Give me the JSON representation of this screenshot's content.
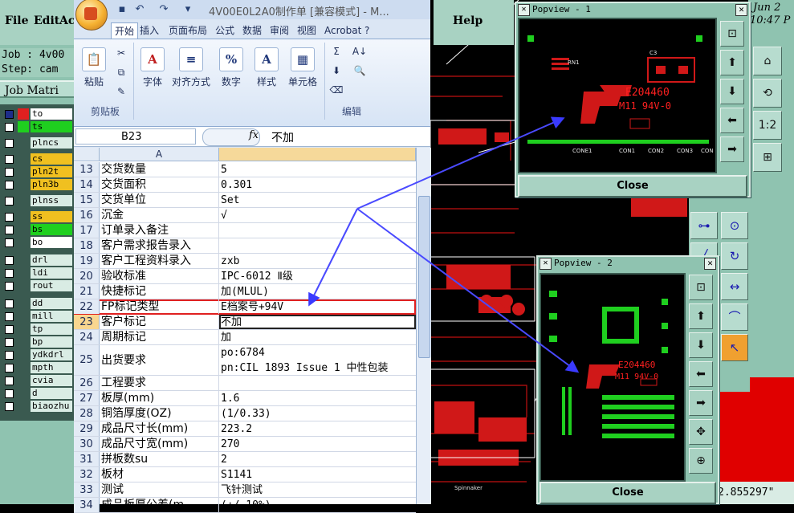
{
  "cam": {
    "menu": [
      "File",
      "Edit",
      "Ac"
    ],
    "job": "Job : 4v00",
    "step": "Step: cam",
    "job_matrix": "Job Matri",
    "layers": [
      {
        "name": "to",
        "color": "#ffffff",
        "swatch": "#e02020",
        "checked": true
      },
      {
        "name": "ts",
        "color": "#1fcf1f",
        "swatch": "#1fcf1f",
        "checked": false
      },
      {
        "name": "plncs",
        "color": "#d9ece4",
        "swatch": "",
        "checked": false
      },
      {
        "name": "cs",
        "color": "#f0c020",
        "swatch": "",
        "checked": false
      },
      {
        "name": "pln2t",
        "color": "#f0c020",
        "swatch": "",
        "checked": false
      },
      {
        "name": "pln3b",
        "color": "#f0c020",
        "swatch": "",
        "checked": false
      },
      {
        "name": "plnss",
        "color": "#d9ece4",
        "swatch": "",
        "checked": false
      },
      {
        "name": "ss",
        "color": "#f0c020",
        "swatch": "",
        "checked": false
      },
      {
        "name": "bs",
        "color": "#1fcf1f",
        "swatch": "",
        "checked": false
      },
      {
        "name": "bo",
        "color": "#ffffff",
        "swatch": "",
        "checked": false
      },
      {
        "name": "drl",
        "color": "#d9ece4",
        "swatch": "",
        "checked": false
      },
      {
        "name": "ldi",
        "color": "#d9ece4",
        "swatch": "",
        "checked": false
      },
      {
        "name": "rout",
        "color": "#d9ece4",
        "swatch": "",
        "checked": false
      },
      {
        "name": "dd",
        "color": "#d9ece4",
        "swatch": "",
        "checked": false
      },
      {
        "name": "mill",
        "color": "#d9ece4",
        "swatch": "",
        "checked": false
      },
      {
        "name": "tp",
        "color": "#d9ece4",
        "swatch": "",
        "checked": false
      },
      {
        "name": "bp",
        "color": "#d9ece4",
        "swatch": "",
        "checked": false
      },
      {
        "name": "ydkdrl",
        "color": "#d9ece4",
        "swatch": "",
        "checked": false
      },
      {
        "name": "mpth",
        "color": "#d9ece4",
        "swatch": "",
        "checked": false
      },
      {
        "name": "cvia",
        "color": "#d9ece4",
        "swatch": "",
        "checked": false
      },
      {
        "name": "d",
        "color": "#d9ece4",
        "swatch": "",
        "checked": false
      },
      {
        "name": "biaozhu",
        "color": "#d9ece4",
        "swatch": "",
        "checked": false
      }
    ],
    "help": "Help",
    "date": "Jun 2",
    "time": "10:47 P",
    "coord": "2.855297\""
  },
  "excel": {
    "title": "4V00E0L2A0制作单 [兼容模式] - M...",
    "tabs": [
      "开始",
      "插入",
      "页面布局",
      "公式",
      "数据",
      "审阅",
      "视图",
      "Acrobat"
    ],
    "groups": {
      "clipboard": {
        "paste": "粘贴",
        "label": "剪贴板"
      },
      "font": "字体",
      "align": "对齐方式",
      "number": "数字",
      "style": "样式",
      "cells": "单元格",
      "edit": "编辑"
    },
    "name_box": "B23",
    "fx": "fx",
    "formula_value": "不加",
    "col_a": "A",
    "rows": [
      {
        "n": "13",
        "a": "交货数量",
        "b": "5"
      },
      {
        "n": "14",
        "a": "交货面积",
        "b": "0.301"
      },
      {
        "n": "15",
        "a": "交货单位",
        "b": "Set"
      },
      {
        "n": "16",
        "a": "沉金",
        "b": "√"
      },
      {
        "n": "17",
        "a": "订单录入备注",
        "b": ""
      },
      {
        "n": "18",
        "a": "客户需求报告录入",
        "b": ""
      },
      {
        "n": "19",
        "a": "客户工程资料录入",
        "b": "zxb"
      },
      {
        "n": "20",
        "a": "验收标准",
        "b": "IPC-6012 Ⅱ级"
      },
      {
        "n": "21",
        "a": "快捷标记",
        "b": "加(MLUL)"
      },
      {
        "n": "22",
        "a": "FP标记类型",
        "b": "E档案号+94V"
      },
      {
        "n": "23",
        "a": "客户标记",
        "b": "不加"
      },
      {
        "n": "24",
        "a": "周期标记",
        "b": "加"
      },
      {
        "n": "25",
        "a": "出货要求",
        "b": "po:6784",
        "b2": "pn:CIL 1893 Issue 1 中性包装"
      },
      {
        "n": "26",
        "a": "工程要求",
        "b": ""
      },
      {
        "n": "27",
        "a": "板厚(mm)",
        "b": "1.6"
      },
      {
        "n": "28",
        "a": "铜箔厚度(OZ)",
        "b": "(1/0.33)"
      },
      {
        "n": "29",
        "a": "成品尺寸长(mm)",
        "b": "223.2"
      },
      {
        "n": "30",
        "a": "成品尺寸宽(mm)",
        "b": "270"
      },
      {
        "n": "31",
        "a": "拼板数su",
        "b": "2"
      },
      {
        "n": "32",
        "a": "板材",
        "b": "S1141"
      },
      {
        "n": "33",
        "a": "测试",
        "b": "飞针测试"
      },
      {
        "n": "34",
        "a": "成品板厚公差(m",
        "b": "(+/-10%)"
      }
    ]
  },
  "pop1": {
    "title": "Popview - 1",
    "close": "Close",
    "marking": "E204460",
    "marking2": "M11 94V-0",
    "labels": [
      "RN1",
      "C3",
      "CONE1",
      "CON1",
      "CON2",
      "CON3",
      "CON"
    ]
  },
  "pop2": {
    "title": "Popview - 2",
    "close": "Close",
    "marking": "E204460",
    "marking2": "M11 94V-0"
  }
}
